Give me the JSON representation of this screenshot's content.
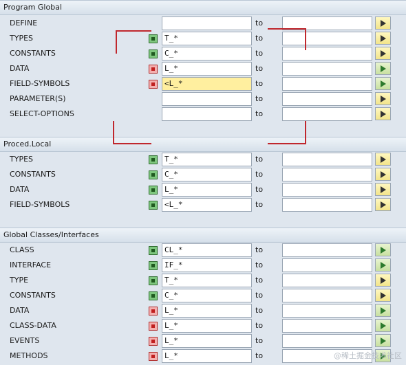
{
  "to_label": "to",
  "watermark": "@稀土掘金技术社区",
  "program_global": {
    "title": "Program Global",
    "rows": [
      {
        "label": "DEFINE",
        "icon": "none",
        "value": ""
      },
      {
        "label": "TYPES",
        "icon": "include-green",
        "value": "T_*"
      },
      {
        "label": "CONSTANTS",
        "icon": "include-green",
        "value": "C_*"
      },
      {
        "label": "DATA",
        "icon": "exclude-red",
        "value": "L_*"
      },
      {
        "label": "FIELD-SYMBOLS",
        "icon": "exclude-red",
        "value": "<L_*"
      },
      {
        "label": "PARAMETER(S)",
        "icon": "none",
        "value": ""
      },
      {
        "label": "SELECT-OPTIONS",
        "icon": "none",
        "value": ""
      }
    ]
  },
  "proced_local": {
    "title": "Proced.Local",
    "rows": [
      {
        "label": "TYPES",
        "icon": "include-green",
        "value": "T_*"
      },
      {
        "label": "CONSTANTS",
        "icon": "include-green",
        "value": "C_*"
      },
      {
        "label": "DATA",
        "icon": "include-green",
        "value": "L_*"
      },
      {
        "label": "FIELD-SYMBOLS",
        "icon": "include-green",
        "value": "<L_*"
      }
    ]
  },
  "global_classes": {
    "title": "Global Classes/Interfaces",
    "rows": [
      {
        "label": "CLASS",
        "icon": "include-green",
        "value": "CL_*"
      },
      {
        "label": "INTERFACE",
        "icon": "include-green",
        "value": "IF_*"
      },
      {
        "label": "TYPE",
        "icon": "include-green",
        "value": "T_*"
      },
      {
        "label": "CONSTANTS",
        "icon": "include-green",
        "value": "C_*"
      },
      {
        "label": "DATA",
        "icon": "exclude-red",
        "value": "L_*"
      },
      {
        "label": "CLASS-DATA",
        "icon": "exclude-red",
        "value": "L_*"
      },
      {
        "label": "EVENTS",
        "icon": "exclude-red",
        "value": "L_*"
      },
      {
        "label": "METHODS",
        "icon": "exclude-red",
        "value": "L_*"
      }
    ]
  }
}
